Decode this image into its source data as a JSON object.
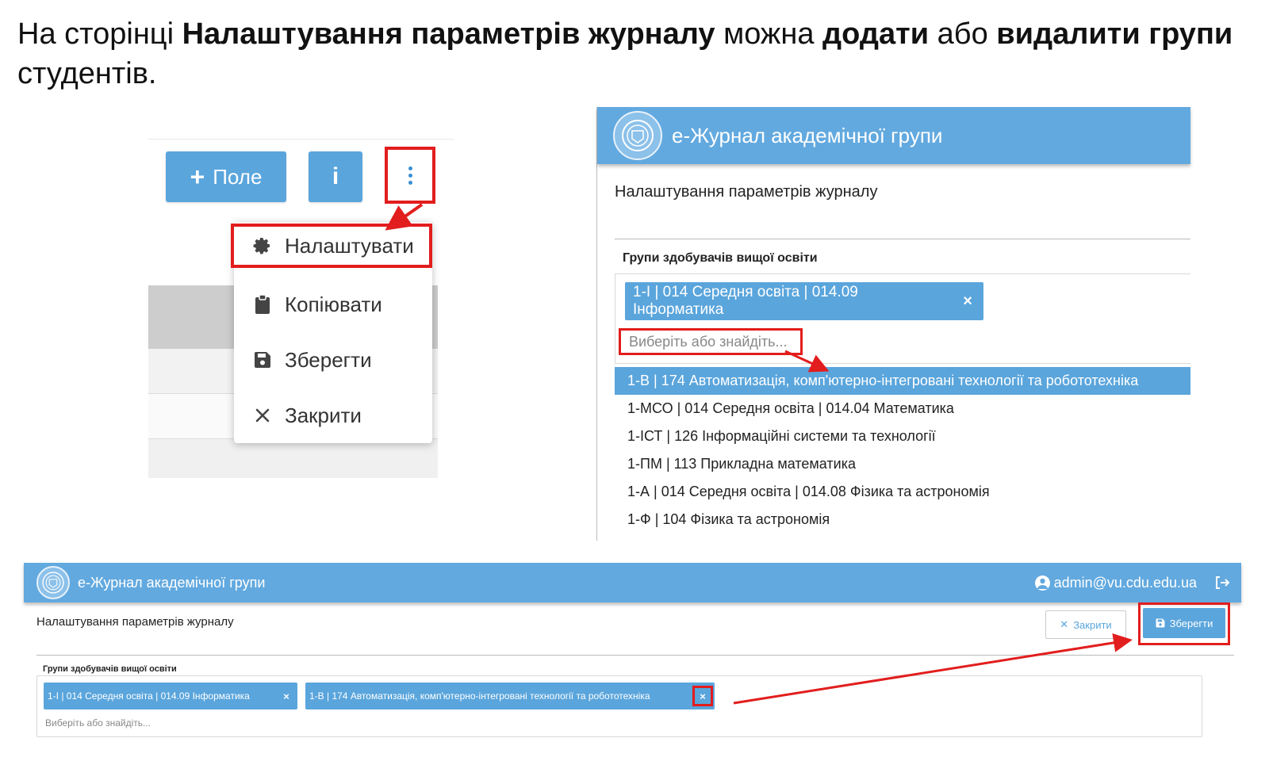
{
  "headline": {
    "part1": "На сторінці ",
    "bold1": "Налаштування параметрів журналу",
    "part2": " можна ",
    "bold2": "додати",
    "part3": " або ",
    "bold3": "видалити групи",
    "part4": " студентів."
  },
  "menu_panel": {
    "field_button": "Поле",
    "info_button": "i",
    "items": [
      {
        "label": "Налаштувати",
        "icon": "gear-icon"
      },
      {
        "label": "Копіювати",
        "icon": "clipboard-icon"
      },
      {
        "label": "Зберегти",
        "icon": "save-icon"
      },
      {
        "label": "Закрити",
        "icon": "close-icon"
      }
    ]
  },
  "settings_panel": {
    "app_title": "е-Журнал академічної групи",
    "page_title": "Налаштування параметрів журналу",
    "section_label": "Групи здобувачів вищої освіти",
    "selected_tag": "1-І | 014 Середня освіта | 014.09 Інформатика",
    "search_placeholder": "Виберіть або знайдіть...",
    "options": [
      "1-В | 174 Автоматизація, комп'ютерно-інтегровані технології та робототехніка",
      "1-МСО | 014 Середня освіта | 014.04 Математика",
      "1-ІСТ | 126 Інформаційні системи та технології",
      "1-ПМ | 113 Прикладна математика",
      "1-А | 014 Середня освіта | 014.08 Фізика та астрономія",
      "1-Ф | 104 Фізика та астрономія"
    ]
  },
  "result_panel": {
    "app_title": "е-Журнал академічної групи",
    "user_email": "admin@vu.cdu.edu.ua",
    "page_title": "Налаштування параметрів журналу",
    "close_button": "Закрити",
    "save_button": "Зберегти",
    "section_label": "Групи здобувачів вищої освіти",
    "tags": [
      "1-І | 014 Середня освіта | 014.09 Інформатика",
      "1-В | 174 Автоматизація, комп'ютерно-інтегровані технології та робототехніка"
    ],
    "search_placeholder": "Виберіть або знайдіть..."
  },
  "colors": {
    "header_blue": "#62a9df",
    "button_blue": "#5aa5dc",
    "highlight_red": "#e21d1d"
  }
}
